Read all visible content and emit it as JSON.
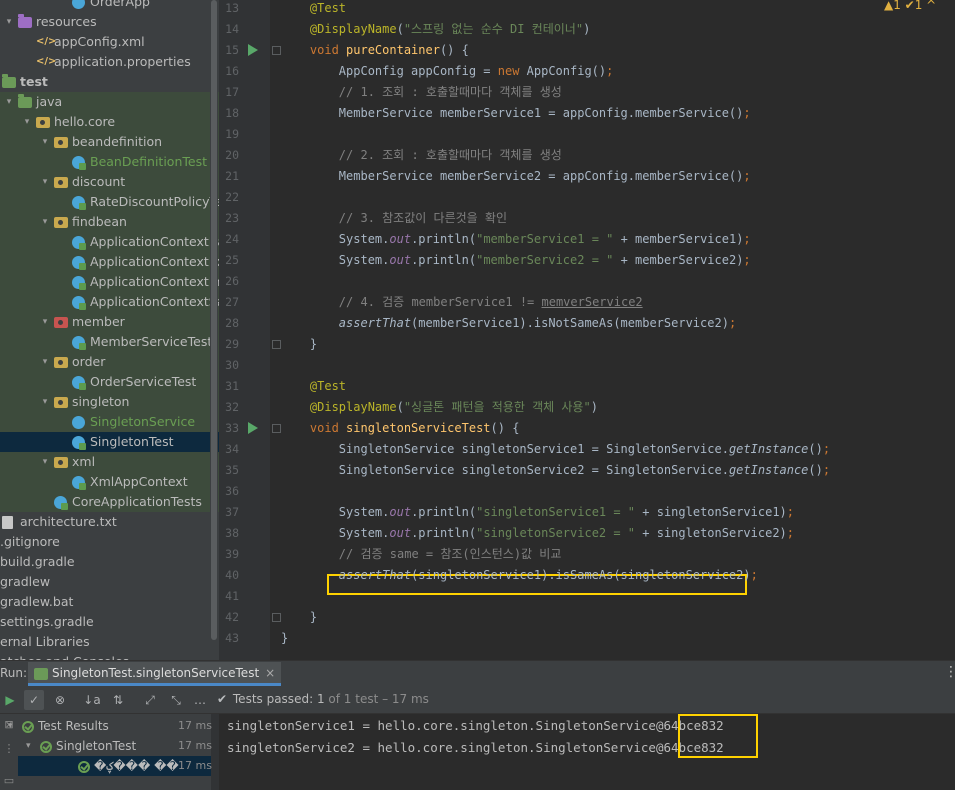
{
  "project_tree": {
    "items": [
      {
        "label": "OrderApp",
        "icon": "class-icon",
        "indent": 70,
        "style": "normal"
      },
      {
        "label": "resources",
        "icon": "resources-folder-icon",
        "indent": 16,
        "style": "normal"
      },
      {
        "label": "appConfig.xml",
        "icon": "xml-file-icon",
        "indent": 34,
        "style": "normal"
      },
      {
        "label": "application.properties",
        "icon": "properties-file-icon",
        "indent": 34,
        "style": "normal"
      },
      {
        "label": "test",
        "icon": "test-folder-icon",
        "indent": 0,
        "style": "bold"
      },
      {
        "label": "java",
        "icon": "test-source-folder-icon",
        "indent": 16,
        "style": "green"
      },
      {
        "label": "hello.core",
        "icon": "package-icon",
        "indent": 34,
        "style": "green"
      },
      {
        "label": "beandefinition",
        "icon": "package-icon",
        "indent": 52,
        "style": "green"
      },
      {
        "label": "BeanDefinitionTest",
        "icon": "test-class-icon",
        "indent": 70,
        "style": "green-text"
      },
      {
        "label": "discount",
        "icon": "package-icon",
        "indent": 52,
        "style": "green"
      },
      {
        "label": "RateDiscountPolicyTest",
        "icon": "test-class-icon",
        "indent": 70,
        "style": "green"
      },
      {
        "label": "findbean",
        "icon": "package-icon",
        "indent": 52,
        "style": "green"
      },
      {
        "label": "ApplicationContextBasic",
        "icon": "test-class-icon",
        "indent": 70,
        "style": "green"
      },
      {
        "label": "ApplicationContextExten",
        "icon": "test-class-icon",
        "indent": 70,
        "style": "green"
      },
      {
        "label": "ApplicationContextInfoT",
        "icon": "test-class-icon",
        "indent": 70,
        "style": "green"
      },
      {
        "label": "ApplicationContextSame",
        "icon": "test-class-icon",
        "indent": 70,
        "style": "green"
      },
      {
        "label": "member",
        "icon": "member-package-icon",
        "indent": 52,
        "style": "green"
      },
      {
        "label": "MemberServiceTest",
        "icon": "test-class-icon",
        "indent": 70,
        "style": "green"
      },
      {
        "label": "order",
        "icon": "package-icon",
        "indent": 52,
        "style": "green"
      },
      {
        "label": "OrderServiceTest",
        "icon": "test-class-icon",
        "indent": 70,
        "style": "green"
      },
      {
        "label": "singleton",
        "icon": "package-icon",
        "indent": 52,
        "style": "green"
      },
      {
        "label": "SingletonService",
        "icon": "class-icon",
        "indent": 70,
        "style": "green-text"
      },
      {
        "label": "SingletonTest",
        "icon": "test-class-icon",
        "indent": 70,
        "style": "selected"
      },
      {
        "label": "xml",
        "icon": "package-icon",
        "indent": 52,
        "style": "green"
      },
      {
        "label": "XmlAppContext",
        "icon": "test-class-icon",
        "indent": 70,
        "style": "green"
      },
      {
        "label": "CoreApplicationTests",
        "icon": "test-class-icon",
        "indent": 52,
        "style": "green"
      },
      {
        "label": "architecture.txt",
        "icon": "text-file-icon",
        "indent": 0,
        "style": "normal"
      },
      {
        "label": ".gitignore",
        "icon": "",
        "indent": -4,
        "style": "normal"
      },
      {
        "label": "build.gradle",
        "icon": "",
        "indent": -4,
        "style": "normal"
      },
      {
        "label": "gradlew",
        "icon": "",
        "indent": -4,
        "style": "normal"
      },
      {
        "label": "gradlew.bat",
        "icon": "",
        "indent": -4,
        "style": "normal"
      },
      {
        "label": "settings.gradle",
        "icon": "",
        "indent": -4,
        "style": "normal"
      },
      {
        "label": "ernal Libraries",
        "icon": "",
        "indent": -4,
        "style": "normal"
      },
      {
        "label": "atches and Consoles",
        "icon": "",
        "indent": -4,
        "style": "normal"
      }
    ]
  },
  "editor": {
    "inspections": "▲1  ✔1  ^",
    "lines": [
      {
        "n": "13",
        "tokens": [
          [
            "an",
            "    @Test"
          ]
        ]
      },
      {
        "n": "14",
        "tokens": [
          [
            "an",
            "    @DisplayName"
          ],
          [
            "",
            "("
          ],
          [
            "str",
            "\"스프링 없는 순수 DI 컨테이너\""
          ],
          [
            "",
            ")"
          ]
        ]
      },
      {
        "n": "15",
        "tokens": [
          [
            "kw",
            "    void "
          ],
          [
            "fn",
            "pureContainer"
          ],
          [
            "",
            "() {"
          ]
        ],
        "run": true
      },
      {
        "n": "16",
        "tokens": [
          [
            "",
            "        AppConfig appConfig = "
          ],
          [
            "kw",
            "new "
          ],
          [
            "",
            "AppConfig()"
          ],
          [
            "kw",
            ";"
          ]
        ]
      },
      {
        "n": "17",
        "tokens": [
          [
            "cm",
            "        // 1. 조회 : 호출할때마다 객체를 생성"
          ]
        ]
      },
      {
        "n": "18",
        "tokens": [
          [
            "",
            "        MemberService memberService1 = appConfig.memberService()"
          ],
          [
            "kw",
            ";"
          ]
        ]
      },
      {
        "n": "19",
        "tokens": [
          [
            "",
            ""
          ]
        ]
      },
      {
        "n": "20",
        "tokens": [
          [
            "cm",
            "        // 2. 조회 : 호출할때마다 객체를 생성"
          ]
        ]
      },
      {
        "n": "21",
        "tokens": [
          [
            "",
            "        MemberService memberService2 = appConfig.memberService()"
          ],
          [
            "kw",
            ";"
          ]
        ]
      },
      {
        "n": "22",
        "tokens": [
          [
            "",
            ""
          ]
        ]
      },
      {
        "n": "23",
        "tokens": [
          [
            "cm",
            "        // 3. 참조값이 다른것을 확인"
          ]
        ]
      },
      {
        "n": "24",
        "tokens": [
          [
            "",
            "        System."
          ],
          [
            "st",
            "out"
          ],
          [
            "",
            ".println("
          ],
          [
            "str",
            "\"memberService1 = \""
          ],
          [
            "",
            " + memberService1)"
          ],
          [
            "kw",
            ";"
          ]
        ]
      },
      {
        "n": "25",
        "tokens": [
          [
            "",
            "        System."
          ],
          [
            "st",
            "out"
          ],
          [
            "",
            ".println("
          ],
          [
            "str",
            "\"memberService2 = \""
          ],
          [
            "",
            " + memberService2)"
          ],
          [
            "kw",
            ";"
          ]
        ]
      },
      {
        "n": "26",
        "tokens": [
          [
            "",
            ""
          ]
        ]
      },
      {
        "n": "27",
        "tokens": [
          [
            "cm",
            "        // 4. 검증 memberService1 != "
          ],
          [
            "cm und",
            "memverService2"
          ]
        ]
      },
      {
        "n": "28",
        "tokens": [
          [
            "it",
            "        assertThat"
          ],
          [
            "",
            "(memberService1).isNotSameAs(memberService2)"
          ],
          [
            "kw",
            ";"
          ]
        ]
      },
      {
        "n": "29",
        "tokens": [
          [
            "",
            "    }"
          ]
        ]
      },
      {
        "n": "30",
        "tokens": [
          [
            "",
            ""
          ]
        ]
      },
      {
        "n": "31",
        "tokens": [
          [
            "an",
            "    @Test"
          ]
        ]
      },
      {
        "n": "32",
        "tokens": [
          [
            "an",
            "    @DisplayName"
          ],
          [
            "",
            "("
          ],
          [
            "str",
            "\"싱글톤 패턴을 적용한 객체 사용\""
          ],
          [
            "",
            ")"
          ]
        ]
      },
      {
        "n": "33",
        "tokens": [
          [
            "kw",
            "    void "
          ],
          [
            "fn",
            "singletonServiceTest"
          ],
          [
            "",
            "() {"
          ]
        ],
        "run": true
      },
      {
        "n": "34",
        "tokens": [
          [
            "",
            "        SingletonService singletonService1 = SingletonService."
          ],
          [
            "it",
            "getInstance"
          ],
          [
            "",
            "()"
          ],
          [
            "kw",
            ";"
          ]
        ]
      },
      {
        "n": "35",
        "tokens": [
          [
            "",
            "        SingletonService singletonService2 = SingletonService."
          ],
          [
            "it",
            "getInstance"
          ],
          [
            "",
            "()"
          ],
          [
            "kw",
            ";"
          ]
        ]
      },
      {
        "n": "36",
        "tokens": [
          [
            "",
            ""
          ]
        ]
      },
      {
        "n": "37",
        "tokens": [
          [
            "",
            "        System."
          ],
          [
            "st",
            "out"
          ],
          [
            "",
            ".println("
          ],
          [
            "str",
            "\"singletonService1 = \""
          ],
          [
            "",
            " + singletonService1)"
          ],
          [
            "kw",
            ";"
          ]
        ]
      },
      {
        "n": "38",
        "tokens": [
          [
            "",
            "        System."
          ],
          [
            "st",
            "out"
          ],
          [
            "",
            ".println("
          ],
          [
            "str",
            "\"singletonService2 = \""
          ],
          [
            "",
            " + singletonService2)"
          ],
          [
            "kw",
            ";"
          ]
        ]
      },
      {
        "n": "39",
        "tokens": [
          [
            "cm",
            "        // 검증 same = 참조(인스턴스)값 비교"
          ]
        ]
      },
      {
        "n": "40",
        "tokens": [
          [
            "it",
            "        assertThat"
          ],
          [
            "",
            "(singletonService1).isSameAs(singletonService2)"
          ],
          [
            "kw",
            ";"
          ]
        ]
      },
      {
        "n": "41",
        "tokens": [
          [
            "",
            ""
          ]
        ]
      },
      {
        "n": "42",
        "tokens": [
          [
            "",
            "    }"
          ]
        ]
      },
      {
        "n": "43",
        "tokens": [
          [
            "",
            "}"
          ]
        ]
      }
    ]
  },
  "run_panel": {
    "label": "Run:",
    "tab_title": "SingletonTest.singletonServiceTest",
    "tab_close": "×",
    "menu": "⋮",
    "status_prefix": "Tests passed:",
    "status_count": "1",
    "status_suffix": "of 1 test – 17 ms",
    "results": [
      {
        "label": "Test Results",
        "time": "17 ms"
      },
      {
        "label": "SingletonTest",
        "time": "17 ms"
      },
      {
        "label": "�ؼ��� ��",
        "time": "17 ms"
      }
    ],
    "console": [
      "singletonService1 = hello.core.singleton.SingletonService@64bce832",
      "singletonService2 = hello.core.singleton.SingletonService@64bce832"
    ]
  },
  "colors": {
    "annotation": "#bbb529",
    "keyword": "#cc7832",
    "string": "#6a8759",
    "comment": "#808080",
    "highlight_box": "#ffd200"
  }
}
